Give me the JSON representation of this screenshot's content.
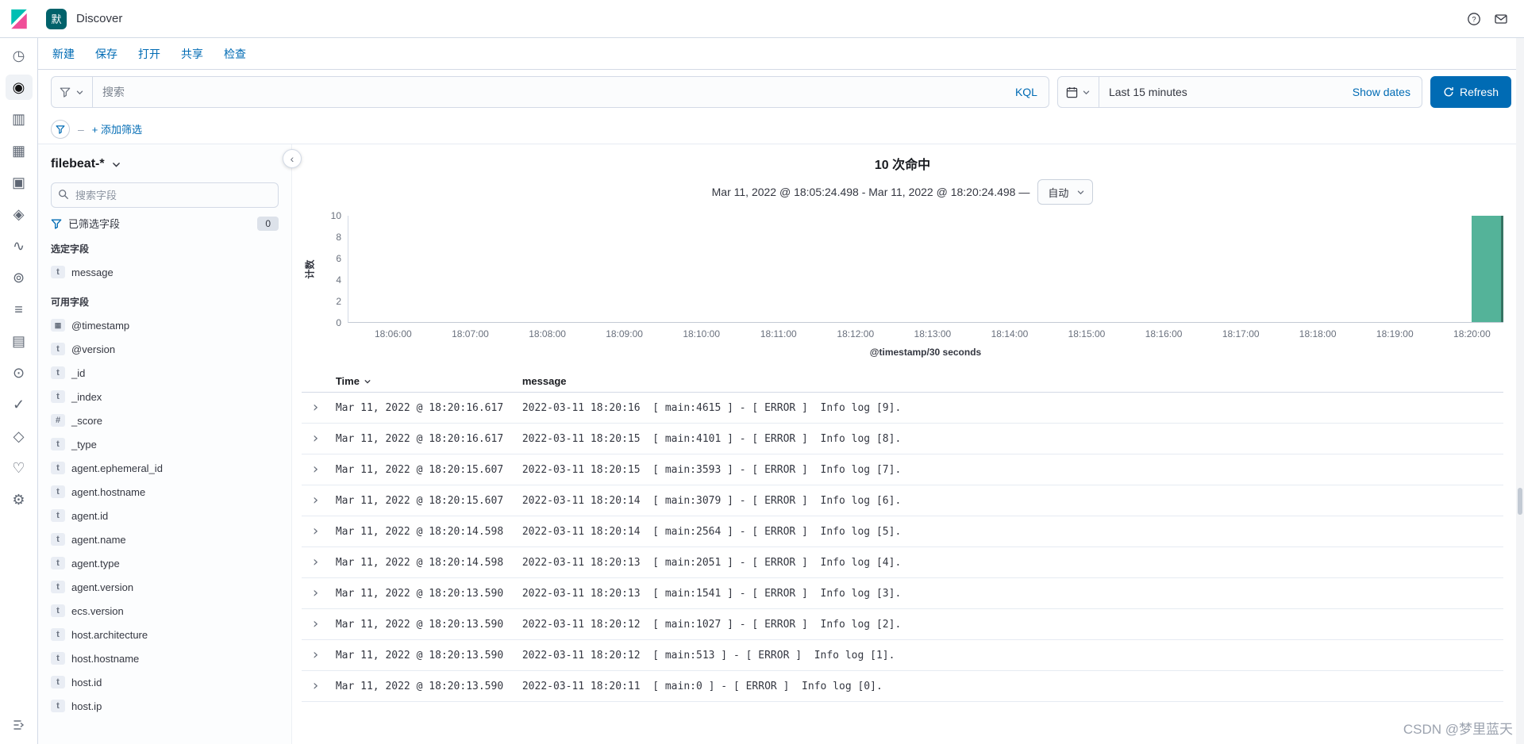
{
  "header": {
    "space_badge": "默",
    "breadcrumb": "Discover",
    "right_icons": [
      "help",
      "newsfeed"
    ]
  },
  "menu": {
    "items": [
      {
        "id": "new",
        "label": "新建"
      },
      {
        "id": "save",
        "label": "保存"
      },
      {
        "id": "open",
        "label": "打开"
      },
      {
        "id": "share",
        "label": "共享"
      },
      {
        "id": "inspect",
        "label": "检查"
      }
    ]
  },
  "query_bar": {
    "search_placeholder": "搜索",
    "language_label": "KQL",
    "time_value": "Last 15 minutes",
    "show_dates_label": "Show dates",
    "refresh_label": "Refresh"
  },
  "filter_bar": {
    "add_filter_label": "+ 添加筛选"
  },
  "nav_rail": {
    "items": [
      {
        "name": "recently-viewed",
        "glyph": "◷",
        "active": false
      },
      {
        "name": "discover",
        "glyph": "◉",
        "active": true
      },
      {
        "name": "visualize",
        "glyph": "▥",
        "active": false
      },
      {
        "name": "dashboard",
        "glyph": "▦",
        "active": false
      },
      {
        "name": "canvas",
        "glyph": "▣",
        "active": false
      },
      {
        "name": "maps",
        "glyph": "◈",
        "active": false
      },
      {
        "name": "machine-learning",
        "glyph": "∿",
        "active": false
      },
      {
        "name": "graph",
        "glyph": "⊚",
        "active": false
      },
      {
        "name": "metrics",
        "glyph": "≡",
        "active": false
      },
      {
        "name": "logs",
        "glyph": "▤",
        "active": false
      },
      {
        "name": "apm",
        "glyph": "⊙",
        "active": false
      },
      {
        "name": "uptime",
        "glyph": "✓",
        "active": false
      },
      {
        "name": "siem",
        "glyph": "◇",
        "active": false
      },
      {
        "name": "stack-monitoring",
        "glyph": "♡",
        "active": false
      },
      {
        "name": "management",
        "glyph": "⚙",
        "active": false
      }
    ]
  },
  "sidebar": {
    "index_pattern": "filebeat-*",
    "field_search_placeholder": "搜索字段",
    "filtered_fields_label": "已筛选字段",
    "filtered_fields_count": "0",
    "selected_section_label": "选定字段",
    "selected_fields": [
      {
        "type": "string",
        "name": "message"
      }
    ],
    "available_section_label": "可用字段",
    "available_fields": [
      {
        "type": "date",
        "name": "@timestamp"
      },
      {
        "type": "string",
        "name": "@version"
      },
      {
        "type": "string",
        "name": "_id"
      },
      {
        "type": "string",
        "name": "_index"
      },
      {
        "type": "number",
        "name": "_score"
      },
      {
        "type": "string",
        "name": "_type"
      },
      {
        "type": "string",
        "name": "agent.ephemeral_id"
      },
      {
        "type": "string",
        "name": "agent.hostname"
      },
      {
        "type": "string",
        "name": "agent.id"
      },
      {
        "type": "string",
        "name": "agent.name"
      },
      {
        "type": "string",
        "name": "agent.type"
      },
      {
        "type": "string",
        "name": "agent.version"
      },
      {
        "type": "string",
        "name": "ecs.version"
      },
      {
        "type": "string",
        "name": "host.architecture"
      },
      {
        "type": "string",
        "name": "host.hostname"
      },
      {
        "type": "string",
        "name": "host.id"
      },
      {
        "type": "string",
        "name": "host.ip"
      }
    ]
  },
  "hits": {
    "count": "10",
    "label": "次命中"
  },
  "chart_data": {
    "type": "bar",
    "title": "10 次命中",
    "subtitle_range": "Mar 11, 2022 @ 18:05:24.498 - Mar 11, 2022 @ 18:20:24.498 —",
    "interval_selector": "自动",
    "xlabel": "@timestamp/30 seconds",
    "ylabel": "计数",
    "ylim": [
      0,
      10
    ],
    "yticks": [
      10,
      8,
      6,
      4,
      2,
      0
    ],
    "xticks": [
      "18:06:00",
      "18:07:00",
      "18:08:00",
      "18:09:00",
      "18:10:00",
      "18:11:00",
      "18:12:00",
      "18:13:00",
      "18:14:00",
      "18:15:00",
      "18:16:00",
      "18:17:00",
      "18:18:00",
      "18:19:00",
      "18:20:00"
    ],
    "x_range": [
      "18:05:24.498",
      "18:20:24.498"
    ],
    "bucket_interval_seconds": 30,
    "buckets": [
      {
        "x": "18:20:00",
        "count": 10
      }
    ],
    "bar_color": "#54B399",
    "grid": false,
    "legend": "none"
  },
  "table": {
    "columns": [
      {
        "label": "Time",
        "sorted": "desc"
      },
      {
        "label": "message"
      }
    ],
    "rows": [
      {
        "time": "Mar 11, 2022 @ 18:20:16.617",
        "message": "2022-03-11 18:20:16  [ main:4615 ] - [ ERROR ]  Info log [9]."
      },
      {
        "time": "Mar 11, 2022 @ 18:20:16.617",
        "message": "2022-03-11 18:20:15  [ main:4101 ] - [ ERROR ]  Info log [8]."
      },
      {
        "time": "Mar 11, 2022 @ 18:20:15.607",
        "message": "2022-03-11 18:20:15  [ main:3593 ] - [ ERROR ]  Info log [7]."
      },
      {
        "time": "Mar 11, 2022 @ 18:20:15.607",
        "message": "2022-03-11 18:20:14  [ main:3079 ] - [ ERROR ]  Info log [6]."
      },
      {
        "time": "Mar 11, 2022 @ 18:20:14.598",
        "message": "2022-03-11 18:20:14  [ main:2564 ] - [ ERROR ]  Info log [5]."
      },
      {
        "time": "Mar 11, 2022 @ 18:20:14.598",
        "message": "2022-03-11 18:20:13  [ main:2051 ] - [ ERROR ]  Info log [4]."
      },
      {
        "time": "Mar 11, 2022 @ 18:20:13.590",
        "message": "2022-03-11 18:20:13  [ main:1541 ] - [ ERROR ]  Info log [3]."
      },
      {
        "time": "Mar 11, 2022 @ 18:20:13.590",
        "message": "2022-03-11 18:20:12  [ main:1027 ] - [ ERROR ]  Info log [2]."
      },
      {
        "time": "Mar 11, 2022 @ 18:20:13.590",
        "message": "2022-03-11 18:20:12  [ main:513 ] - [ ERROR ]  Info log [1]."
      },
      {
        "time": "Mar 11, 2022 @ 18:20:13.590",
        "message": "2022-03-11 18:20:11  [ main:0 ] - [ ERROR ]  Info log [0]."
      }
    ]
  },
  "watermark": "CSDN @梦里蓝天",
  "colors": {
    "accent_blue": "#006BB4",
    "bar_green": "#54B399",
    "space_badge_bg": "#00626B"
  }
}
